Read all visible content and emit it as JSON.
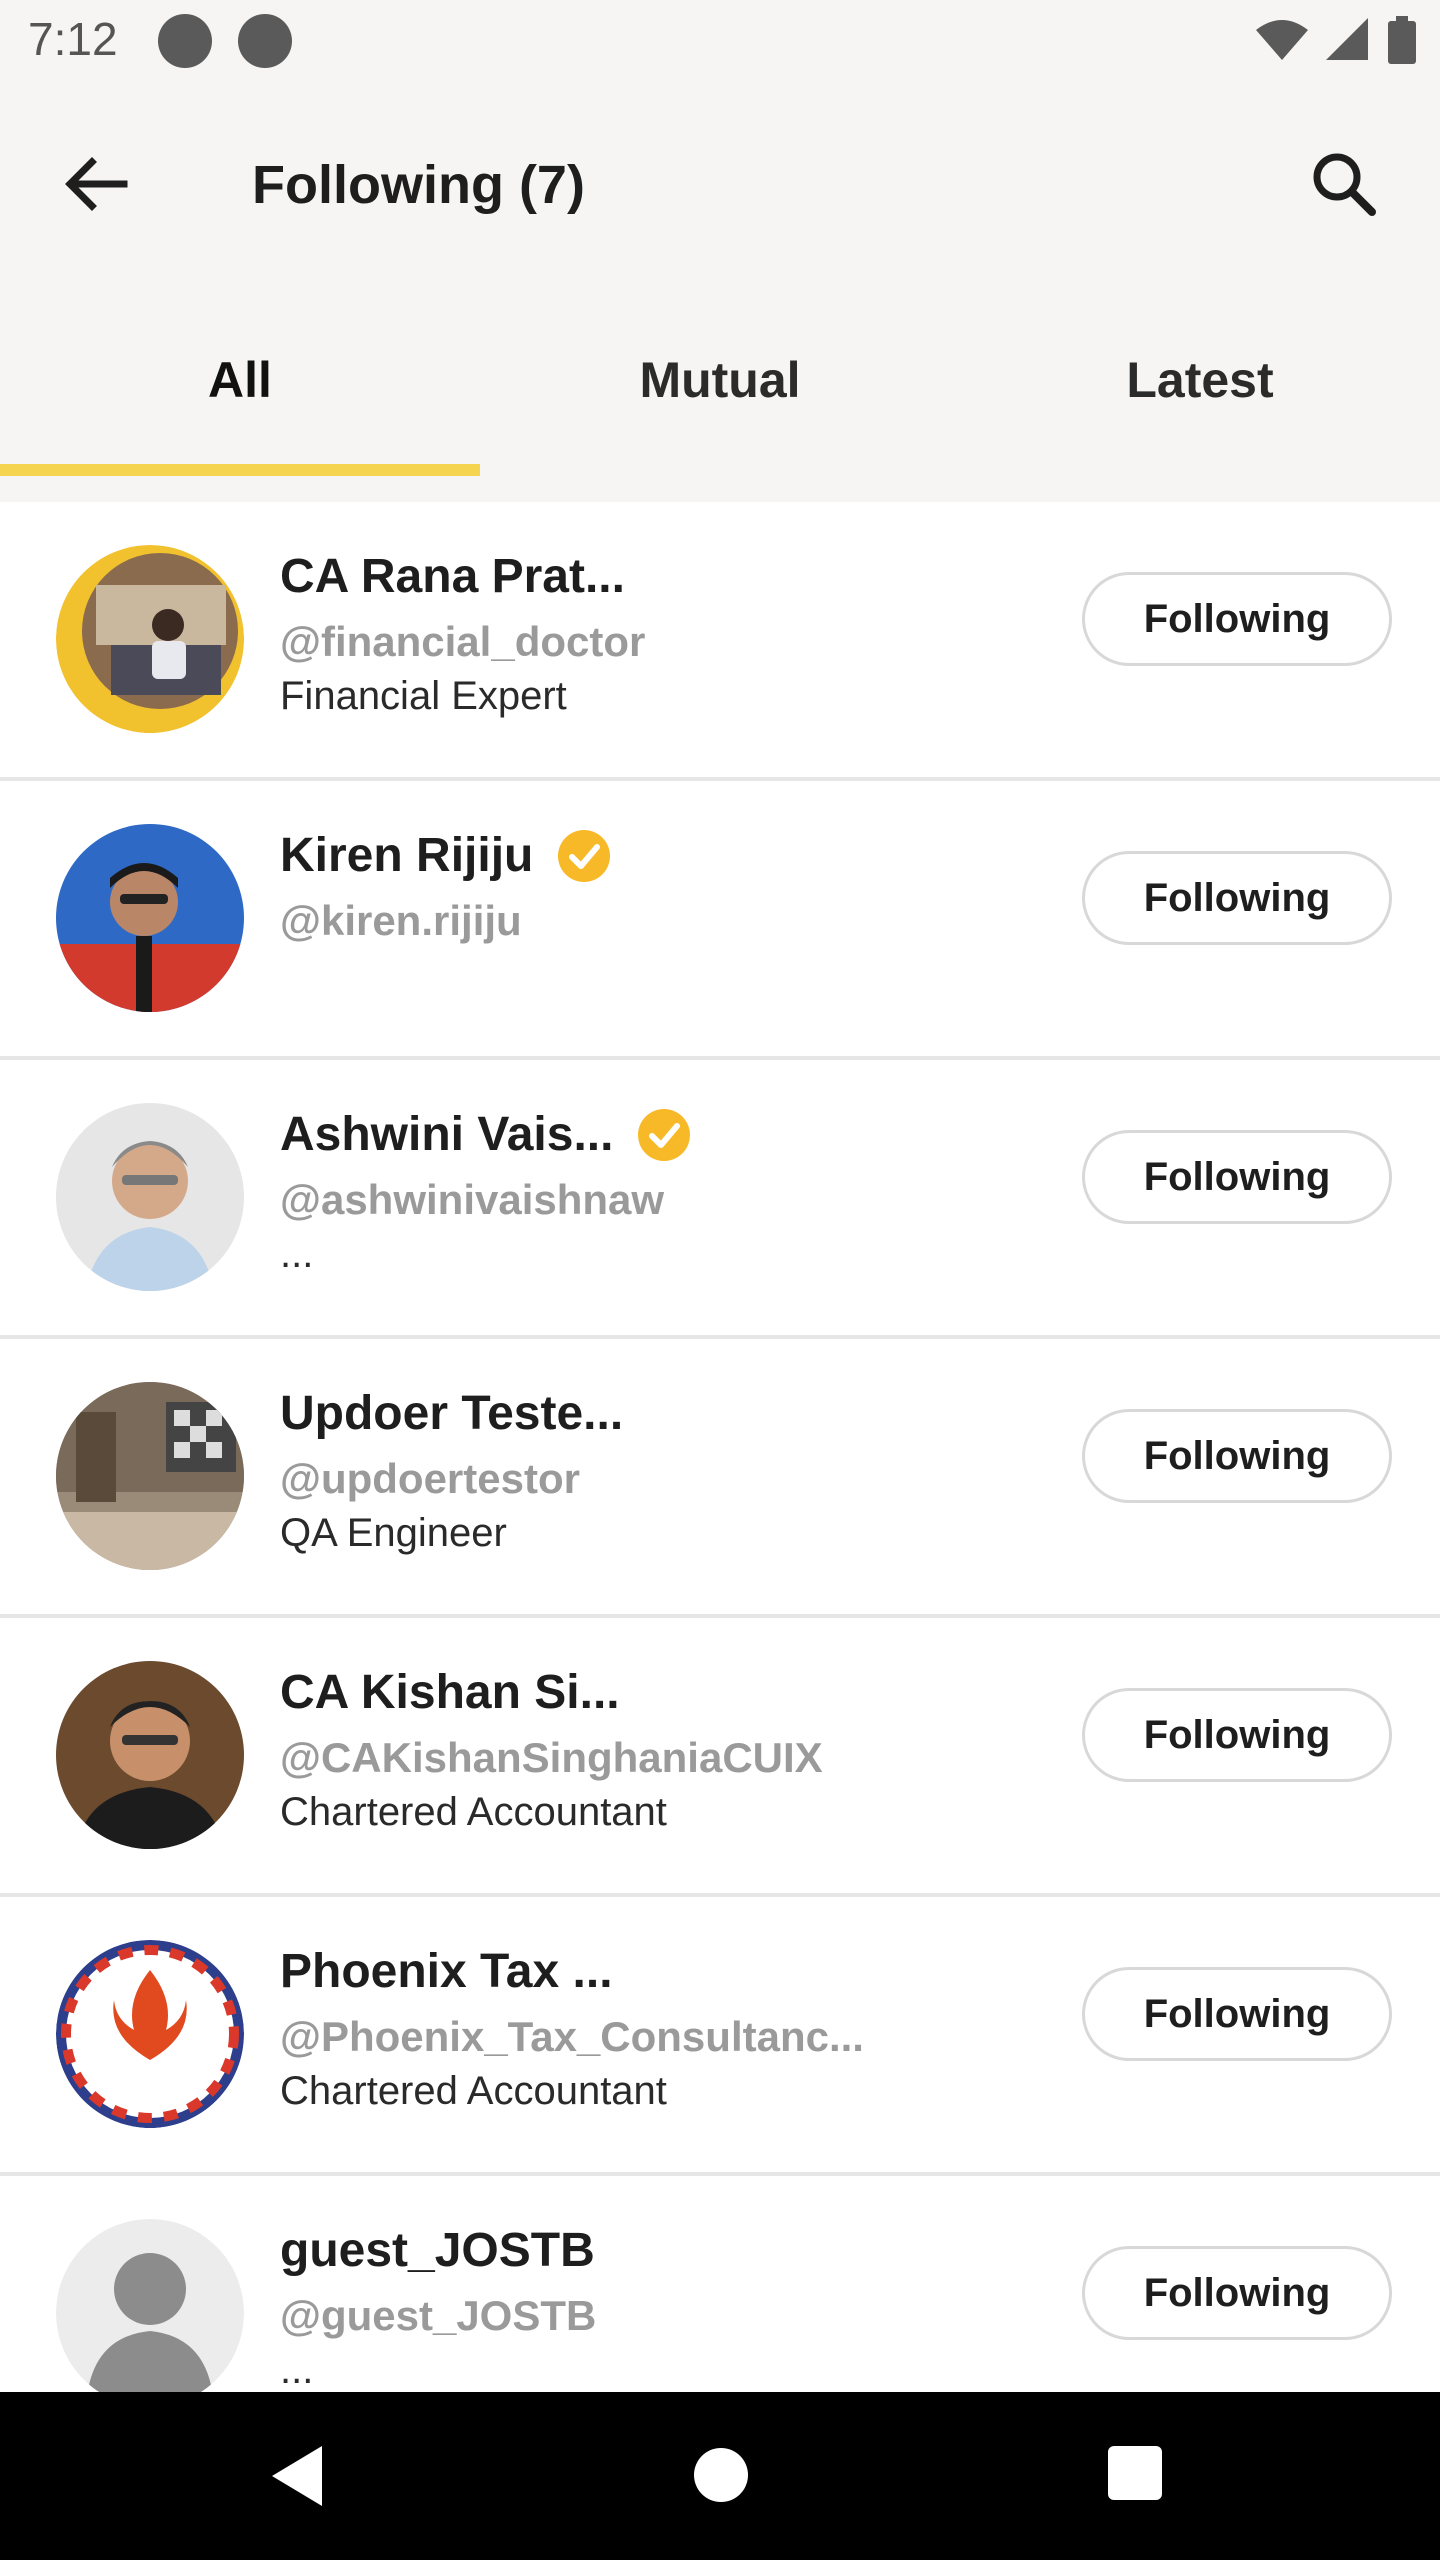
{
  "status_bar": {
    "time": "7:12"
  },
  "app_bar": {
    "title": "Following (7)"
  },
  "tabs": [
    {
      "label": "All",
      "active": true
    },
    {
      "label": "Mutual",
      "active": false
    },
    {
      "label": "Latest",
      "active": false
    }
  ],
  "colors": {
    "accent": "#f5d44f",
    "verified": "#f7b928",
    "handle": "#9a9a9a"
  },
  "users": [
    {
      "name": "CA Rana Prat...",
      "handle": "@financial_doctor",
      "bio": "Financial Expert",
      "verified": false,
      "button": "Following"
    },
    {
      "name": "Kiren Rijiju",
      "handle": "@kiren.rijiju",
      "bio": "",
      "verified": true,
      "button": "Following"
    },
    {
      "name": "Ashwini Vais...",
      "handle": "@ashwinivaishnaw",
      "bio": "...",
      "verified": true,
      "button": "Following"
    },
    {
      "name": "Updoer Teste...",
      "handle": "@updoertestor",
      "bio": "QA Engineer",
      "verified": false,
      "button": "Following"
    },
    {
      "name": "CA Kishan Si...",
      "handle": "@CAKishanSinghaniaCUIX",
      "bio": "Chartered Accountant",
      "verified": false,
      "button": "Following"
    },
    {
      "name": "Phoenix Tax ...",
      "handle": "@Phoenix_Tax_Consultanc...",
      "bio": "Chartered Accountant",
      "verified": false,
      "button": "Following"
    },
    {
      "name": "guest_JOSTB",
      "handle": "@guest_JOSTB",
      "bio": "...",
      "verified": false,
      "button": "Following"
    }
  ]
}
